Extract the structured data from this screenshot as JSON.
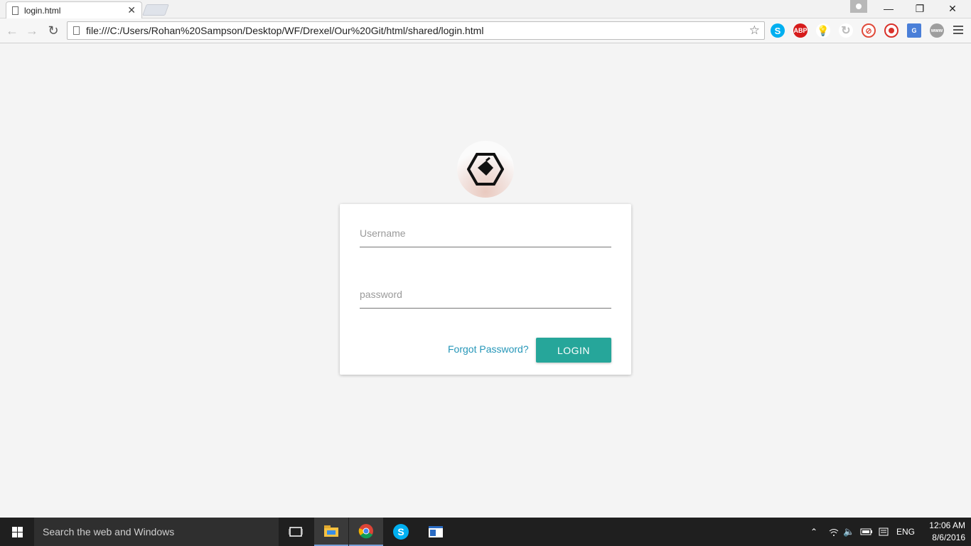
{
  "browser": {
    "tab_title": "login.html",
    "url": "file:///C:/Users/Rohan%20Sampson/Desktop/WF/Drexel/Our%20Git/html/shared/login.html",
    "extensions": [
      "skype-icon",
      "adblock-icon",
      "bulb-icon",
      "refresh-ext-icon",
      "block-icon",
      "record-icon",
      "translate-icon",
      "www-icon"
    ]
  },
  "login": {
    "username_placeholder": "Username",
    "password_placeholder": "password",
    "forgot_label": "Forgot Password?",
    "login_label": "LOGIN",
    "accent_color": "#26a69a",
    "link_color": "#2596b8"
  },
  "taskbar": {
    "search_placeholder": "Search the web and Windows",
    "language": "ENG",
    "time": "12:06 AM",
    "date": "8/6/2016"
  }
}
